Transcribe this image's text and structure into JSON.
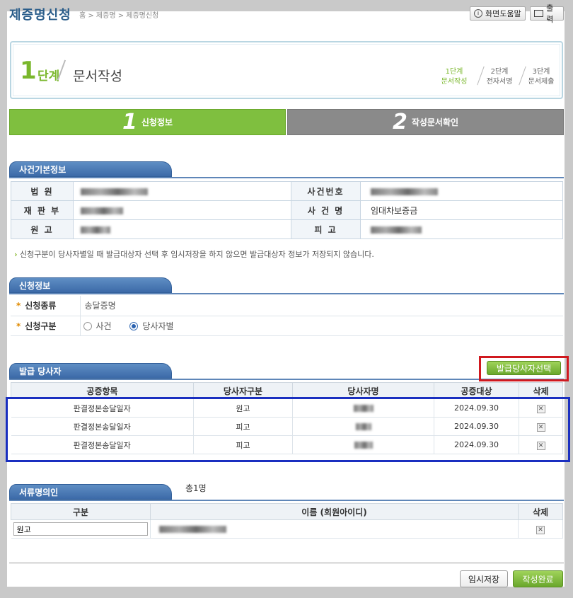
{
  "header": {
    "title": "제증명신청",
    "breadcrumb": "홈 > 제증명 > 제증명신청",
    "help_label": "화면도움말",
    "print_label": "출력"
  },
  "step_box": {
    "num": "1",
    "unit": "단계",
    "name": "문서작성",
    "steps": [
      {
        "line1": "1단계",
        "line2": "문서작성"
      },
      {
        "line1": "2단계",
        "line2": "전자서명"
      },
      {
        "line1": "3단계",
        "line2": "문서제출"
      }
    ]
  },
  "tabs": [
    {
      "num": "1",
      "label": "신청정보"
    },
    {
      "num": "2",
      "label": "작성문서확인"
    }
  ],
  "case_info": {
    "title": "사건기본정보",
    "court_label": "법 원",
    "dept_label": "재 판 부",
    "plaintiff_label": "원 고",
    "caseno_label": "사건번호",
    "casename_label": "사 건 명",
    "casename_value": "임대차보증금",
    "defendant_label": "피 고"
  },
  "note": "신청구분이 당사자별일 때 발급대상자 선택 후 임시저장을 하지 않으면 발급대상자 정보가 저장되지 않습니다.",
  "request": {
    "title": "신청정보",
    "type_label": "신청종류",
    "type_value": "송달증명",
    "kind_label": "신청구분",
    "kind_opt1": "사건",
    "kind_opt2": "당사자별",
    "selected": "당사자별"
  },
  "issue": {
    "title": "발급 당사자",
    "select_button": "발급당사자선택",
    "headers": [
      "공증항목",
      "당사자구분",
      "당사자명",
      "공증대상",
      "삭제"
    ],
    "rows": [
      {
        "item": "판결정본송달일자",
        "party": "원고",
        "date": "2024.09.30"
      },
      {
        "item": "판결정본송달일자",
        "party": "피고",
        "date": "2024.09.30"
      },
      {
        "item": "판결정본송달일자",
        "party": "피고",
        "date": "2024.09.30"
      }
    ]
  },
  "nominee": {
    "title": "서류명의인",
    "count": "총1명",
    "headers": [
      "구분",
      "이름 (회원아이디)",
      "삭제"
    ],
    "row_value": "원고"
  },
  "footer": {
    "temp_save": "임시저장",
    "complete": "작성완료"
  },
  "colors": {
    "accent_green": "#7fbf3f",
    "section_blue": "#3c6aa8",
    "highlight_red": "#d0191f",
    "highlight_blue": "#1a2fc0"
  }
}
